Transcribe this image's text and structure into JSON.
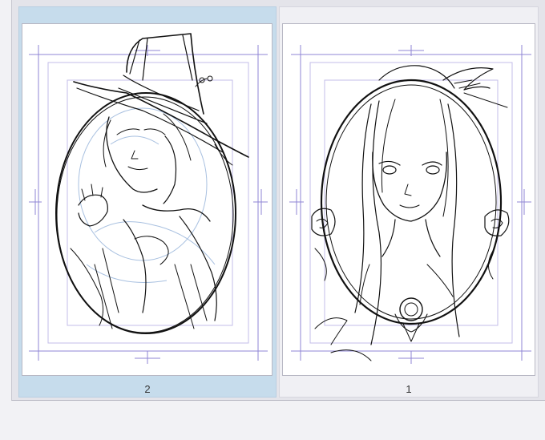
{
  "pages": [
    {
      "id": "page-2",
      "number": "2",
      "selected": true,
      "subject": "man-in-top-hat-portrait"
    },
    {
      "id": "page-1",
      "number": "1",
      "selected": false,
      "subject": "woman-oval-cameo-portrait"
    }
  ],
  "colors": {
    "selected_slot": "#c6dcec",
    "guide_lines": "#8f86d4",
    "ink": "#111111",
    "underdrawing": "#a8c0e0"
  }
}
